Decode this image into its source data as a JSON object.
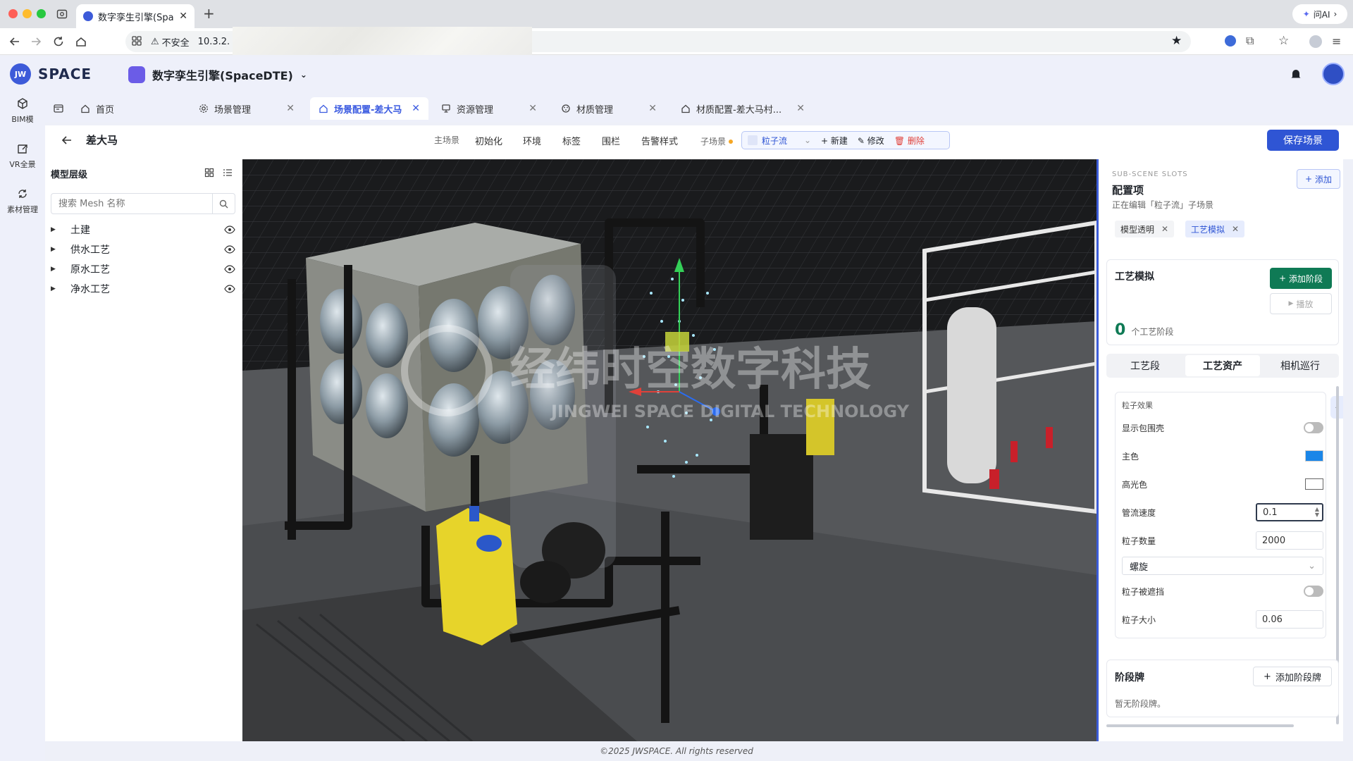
{
  "browser": {
    "tab_title": "数字孪生引擎(Spac",
    "security_label": "不安全",
    "url": "10.3.2.",
    "ask_ai": "问AI"
  },
  "app": {
    "logo_text": "SPACE",
    "project_name": "数字孪生引擎(SpaceDTE)"
  },
  "rail": [
    {
      "label": "BIM模"
    },
    {
      "label": "VR全景"
    },
    {
      "label": "素材管理"
    }
  ],
  "page_tabs": [
    {
      "label": "首页"
    },
    {
      "label": "场景管理"
    },
    {
      "label": "场景配置-差大马"
    },
    {
      "label": "资源管理"
    },
    {
      "label": "材质管理"
    },
    {
      "label": "材质配置-差大马村..."
    }
  ],
  "content_header": {
    "title": "差大马",
    "main_scene_label": "主场景",
    "menu": [
      "初始化",
      "环境",
      "标签",
      "围栏",
      "告警样式"
    ],
    "sub_scene_label": "子场景",
    "sub_scene_value": "粒子流",
    "new_label": "新建",
    "edit_label": "修改",
    "delete_label": "删除",
    "save_label": "保存场景"
  },
  "tree": {
    "title": "模型层级",
    "search_placeholder": "搜索 Mesh 名称",
    "items": [
      {
        "label": "土建"
      },
      {
        "label": "供水工艺"
      },
      {
        "label": "原水工艺"
      },
      {
        "label": "净水工艺"
      }
    ]
  },
  "viewport": {
    "watermark_cn": "经纬时空数字科技",
    "watermark_en": "JINGWEI SPACE DIGITAL TECHNOLOGY"
  },
  "right_panel": {
    "slots_caption": "SUB-SCENE SLOTS",
    "title": "配置项",
    "editing_note": "正在编辑「粒子流」子场景",
    "add_label": "添加",
    "chips": [
      {
        "label": "模型透明"
      },
      {
        "label": "工艺模拟"
      }
    ],
    "process": {
      "title": "工艺模拟",
      "add_stage_label": "添加阶段",
      "play_label": "播放",
      "stage_count": "0",
      "stage_count_label": "个工艺阶段"
    },
    "subtabs": [
      {
        "label": "工艺段"
      },
      {
        "label": "工艺资产"
      },
      {
        "label": "相机巡行"
      }
    ],
    "particle": {
      "section_title": "粒子效果",
      "show_bbox_label": "显示包围壳",
      "main_color_label": "主色",
      "main_color": "#1a86e8",
      "highlight_color_label": "高光色",
      "highlight_color": "#ffffff",
      "flow_speed_label": "管流速度",
      "flow_speed": "0.1",
      "count_label": "粒子数量",
      "count": "2000",
      "mode": "螺旋",
      "occluded_label": "粒子被遮挡",
      "size_label": "粒子大小",
      "size": "0.06"
    },
    "stage_board": {
      "title": "阶段牌",
      "add_label": "添加阶段牌",
      "empty": "暂无阶段牌。"
    }
  },
  "footer": "©2025 JWSPACE. All rights reserved",
  "colors": {
    "accent": "#2f55d4",
    "green": "#0f7a55",
    "danger": "#e0413a"
  }
}
